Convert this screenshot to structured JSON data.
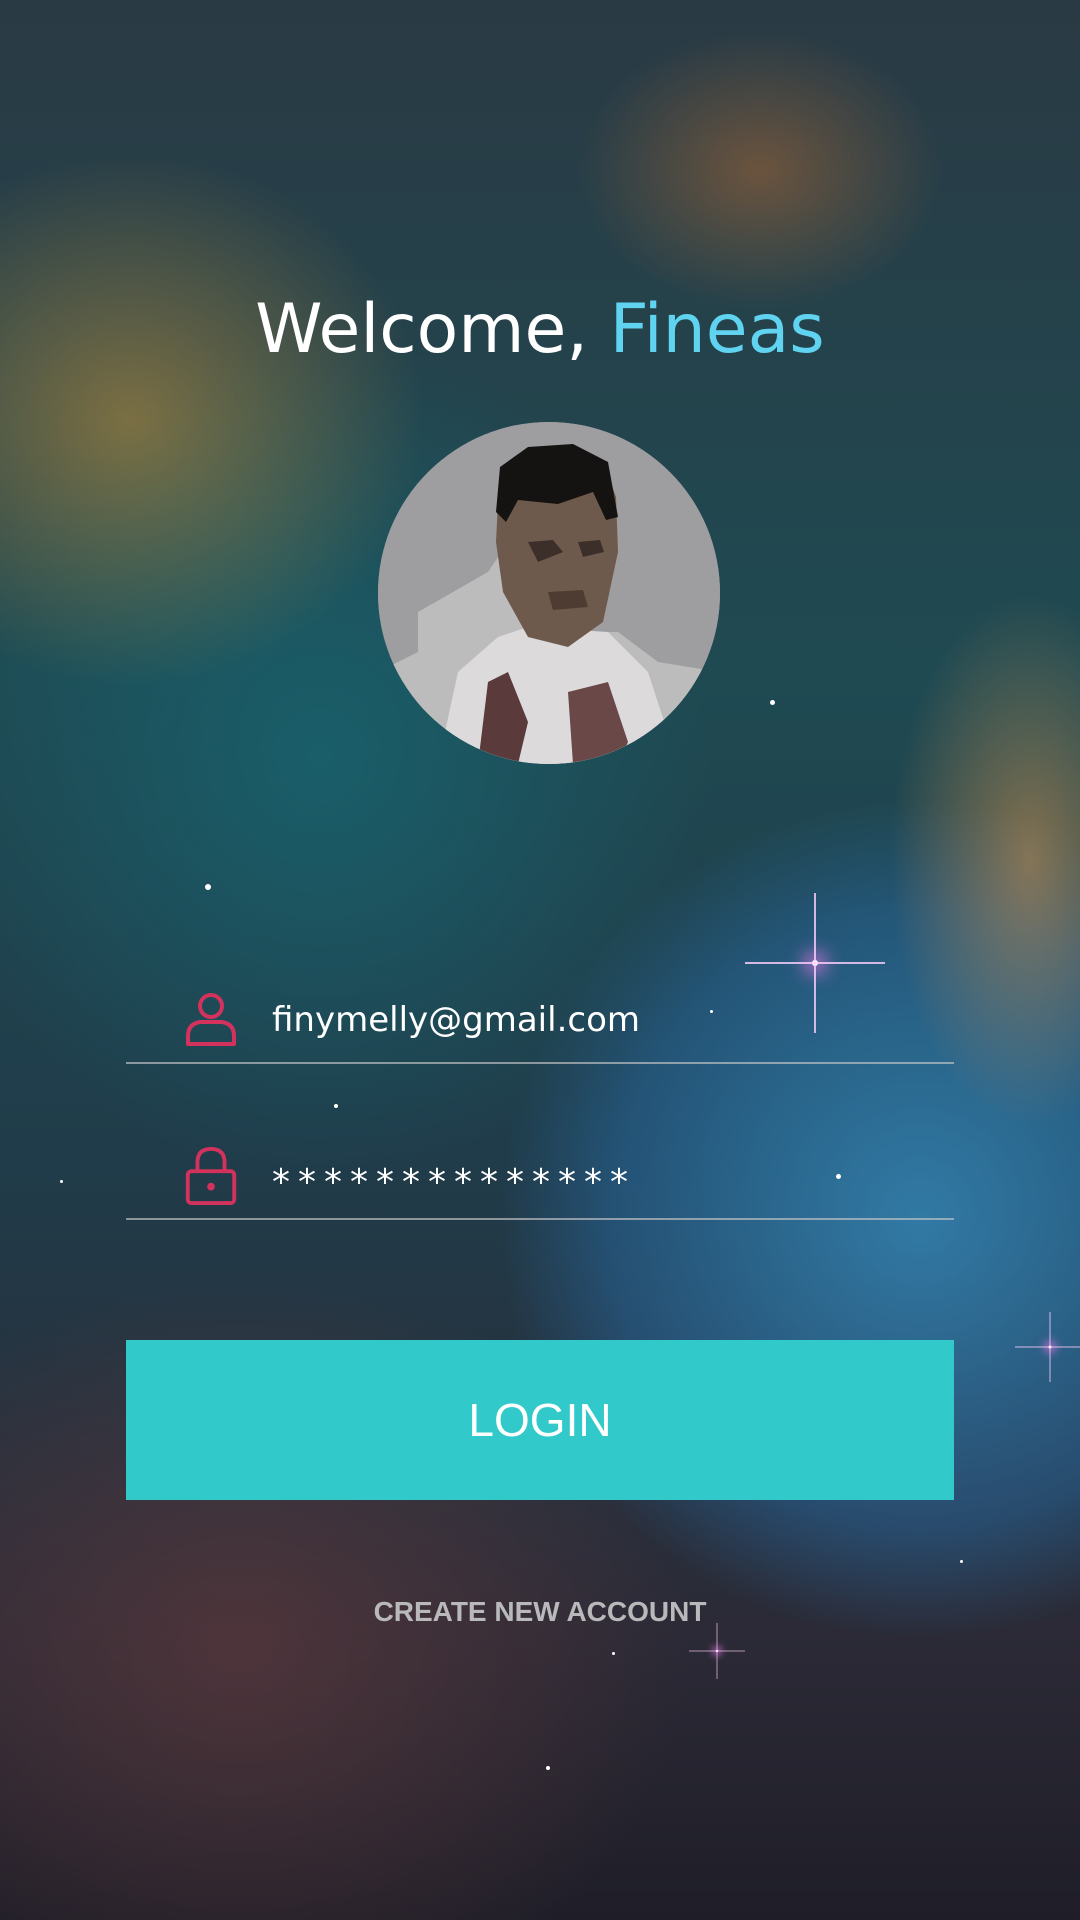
{
  "header": {
    "welcome_text": "Welcome,",
    "user_name": "Fineas"
  },
  "avatar": {
    "icon": "profile-photo"
  },
  "form": {
    "email_value": "finymelly@gmail.com",
    "email_icon": "user-icon",
    "password_value": "**************",
    "password_icon": "lock-icon"
  },
  "actions": {
    "login_label": "LOGIN",
    "create_account_label": "CREATE NEW ACCOUNT"
  },
  "colors": {
    "accent_name": "#5fd3ef",
    "icon_color": "#d2325c",
    "button_bg": "#31c9c9",
    "secondary_text": "#b9b9bb"
  }
}
